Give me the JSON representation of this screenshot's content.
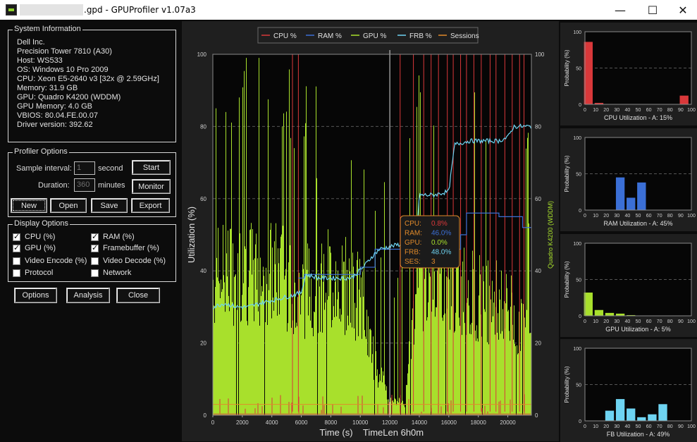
{
  "window": {
    "title": ".gpd - GPUProfiler v1.07a3",
    "controls": {
      "minimize": "—",
      "maximize": "☐",
      "close": "✕"
    }
  },
  "system_info": {
    "title": "System Information",
    "lines": [
      "Dell Inc.",
      "Precision Tower 7810 (A30)",
      "Host: WS533",
      "OS: Windows 10 Pro 2009",
      "CPU: Xeon E5-2640 v3 [32x @ 2.59GHz]",
      "Memory: 31.9 GB",
      "GPU: Quadro K4200 (WDDM)",
      "GPU Memory: 4.0 GB",
      "VBIOS: 80.04.FE.00.07",
      "Driver version: 392.62"
    ]
  },
  "profiler_options": {
    "title": "Profiler Options",
    "sample_interval_label": "Sample interval:",
    "sample_interval_value": "1",
    "sample_interval_unit": "second",
    "duration_label": "Duration:",
    "duration_value": "360",
    "duration_unit": "minutes",
    "start_label": "Start",
    "monitor_label": "Monitor",
    "new_label": "New",
    "open_label": "Open",
    "save_label": "Save",
    "export_label": "Export"
  },
  "display_options": {
    "title": "Display Options",
    "items": [
      {
        "label": "CPU (%)",
        "checked": true
      },
      {
        "label": "RAM (%)",
        "checked": true
      },
      {
        "label": "GPU (%)",
        "checked": true
      },
      {
        "label": "Framebuffer (%)",
        "checked": true
      },
      {
        "label": "Video Encode (%)",
        "checked": false
      },
      {
        "label": "Video Decode (%)",
        "checked": false
      },
      {
        "label": "Protocol",
        "checked": false
      },
      {
        "label": "Network",
        "checked": false
      }
    ]
  },
  "bottom_buttons": {
    "options": "Options",
    "analysis": "Analysis",
    "close": "Close"
  },
  "colors": {
    "cpu": "#d9383a",
    "ram": "#3b6fd6",
    "gpu": "#a8e02c",
    "frb": "#6ed4f2",
    "sessions": "#e08a2a",
    "panel_bg": "#1f1f1f",
    "grid": "#555555",
    "axis_text": "#cfcfcf"
  },
  "chart_data": [
    {
      "type": "line",
      "legend": [
        "CPU %",
        "RAM %",
        "GPU %",
        "FRB %",
        "Sessions"
      ],
      "ylabel": "Utilization (%)",
      "ylabel_right": "Quadro K4200 (WDDM)",
      "xlabel": "Time (s)",
      "timelen_label": "TimeLen 6h0m",
      "xlim": [
        0,
        21600
      ],
      "ylim": [
        0,
        100
      ],
      "x_ticks": [
        0,
        2000,
        4000,
        6000,
        8000,
        10000,
        12000,
        14000,
        16000,
        18000,
        20000
      ],
      "y_ticks": [
        0,
        20,
        40,
        60,
        80,
        100
      ],
      "cursor_x": 12000,
      "tooltip": [
        {
          "label": "CPU:",
          "value": "0.8%",
          "series": "cpu"
        },
        {
          "label": "RAM:",
          "value": "46.0%",
          "series": "ram"
        },
        {
          "label": "GPU:",
          "value": "0.0%",
          "series": "gpu"
        },
        {
          "label": "FRB:",
          "value": "48.0%",
          "series": "frb"
        },
        {
          "label": "SES:",
          "value": "3",
          "series": "sessions"
        }
      ],
      "series": [
        {
          "name": "FRB %",
          "key": "frb",
          "x": [
            0,
            800,
            1600,
            2400,
            3200,
            4200,
            5200,
            6000,
            6300,
            7200,
            8200,
            9400,
            10200,
            10800,
            11300,
            12300,
            13400,
            13800,
            14000,
            15000,
            16000,
            16400,
            17400,
            18400,
            19400,
            20000,
            20400,
            20800,
            21600
          ],
          "values": [
            30,
            31,
            30,
            30,
            31,
            32,
            33,
            34,
            39,
            38,
            38,
            38,
            41,
            44,
            46,
            47,
            48,
            48,
            61,
            61,
            62,
            75,
            76,
            76,
            76,
            77,
            80,
            80,
            80
          ]
        },
        {
          "name": "RAM %",
          "key": "ram",
          "x": [
            5800,
            6200,
            7200,
            9000,
            10000,
            11000,
            13500,
            14000,
            15800,
            16800,
            17200,
            18400,
            19400,
            20500,
            21000,
            21600
          ],
          "values": [
            38,
            39,
            39,
            39,
            41,
            46,
            46,
            46,
            46,
            50,
            56,
            56,
            55,
            55,
            52,
            52
          ]
        },
        {
          "name": "Sessions",
          "key": "sessions",
          "x": [
            0,
            21600
          ],
          "values": [
            3,
            3
          ]
        }
      ],
      "gpu_profile": {
        "x": [
          0,
          1000,
          2000,
          3000,
          4000,
          5000,
          5500,
          6000,
          7000,
          8000,
          9000,
          10000,
          10500,
          11000,
          11500,
          12000,
          13000,
          13800,
          14500,
          15500,
          16500,
          17500,
          18500,
          19500,
          20500,
          21600
        ],
        "values": [
          42,
          45,
          44,
          43,
          44,
          42,
          40,
          38,
          40,
          42,
          40,
          36,
          25,
          15,
          10,
          4,
          4,
          40,
          42,
          45,
          40,
          38,
          36,
          34,
          30,
          25
        ]
      },
      "cpu_spikes_x": [
        5400,
        5800,
        12700,
        13600,
        14300,
        14800,
        15300,
        15900,
        16300,
        16800,
        17200,
        17700,
        18200,
        18800,
        19200,
        19800,
        20300,
        20800,
        21100
      ]
    },
    {
      "type": "bar",
      "title": "CPU Utilization - A: 15%",
      "xlabel": "CPU Utilization - A: 15%",
      "ylabel": "Probability (%)",
      "categories": [
        0,
        10,
        20,
        30,
        40,
        50,
        60,
        70,
        80,
        90,
        100
      ],
      "values": [
        86,
        2,
        0,
        0,
        0,
        0,
        0,
        0,
        0,
        12,
        0
      ],
      "color_key": "cpu"
    },
    {
      "type": "bar",
      "title": "RAM Utilization - A: 45%",
      "xlabel": "RAM Utilization - A: 45%",
      "ylabel": "Probability (%)",
      "categories": [
        0,
        10,
        20,
        30,
        40,
        50,
        60,
        70,
        80,
        90,
        100
      ],
      "values": [
        0,
        0,
        0,
        45,
        17,
        38,
        0,
        0,
        0,
        0,
        0
      ],
      "color_key": "ram"
    },
    {
      "type": "bar",
      "title": "GPU Utilization - A: 5%",
      "xlabel": "GPU Utilization - A: 5%",
      "ylabel": "Probability (%)",
      "categories": [
        0,
        10,
        20,
        30,
        40,
        50,
        60,
        70,
        80,
        90,
        100
      ],
      "values": [
        32,
        8,
        4,
        3,
        1,
        0,
        0,
        0,
        0,
        0,
        0
      ],
      "color_key": "gpu"
    },
    {
      "type": "bar",
      "title": "FB Utilization - A: 49%",
      "xlabel": "FB Utilization - A: 49%",
      "ylabel": "Probability (%)",
      "categories": [
        0,
        10,
        20,
        30,
        40,
        50,
        60,
        70,
        80,
        90,
        100
      ],
      "values": [
        0,
        0,
        14,
        30,
        17,
        5,
        9,
        23,
        0,
        0,
        0
      ],
      "color_key": "frb"
    }
  ]
}
